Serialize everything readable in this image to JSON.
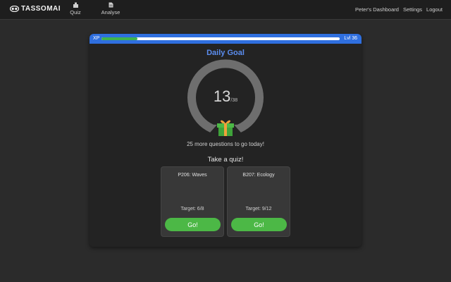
{
  "app": {
    "logo_text": "TASSOMAI"
  },
  "nav": {
    "quiz_label": "Quiz",
    "analyse_label": "Analyse"
  },
  "header_links": {
    "dashboard": "Peter's Dashboard",
    "settings": "Settings",
    "logout": "Logout"
  },
  "xp": {
    "label": "XP",
    "level": "Lvl 36",
    "progress": 0.15,
    "fill_color": "#3fb34f",
    "bar_color": "#2f6fdf"
  },
  "daily_goal": {
    "title": "Daily Goal",
    "completed": "13",
    "total": "/38",
    "progress": 0.34,
    "remaining_text": "25 more questions to go today!",
    "icon": "gift-icon"
  },
  "quizzes": {
    "heading": "Take a quiz!",
    "items": [
      {
        "name": "P206: Waves",
        "target": "Target: 6/8",
        "button": "Go!"
      },
      {
        "name": "B207: Ecology",
        "target": "Target: 9/12",
        "button": "Go!"
      }
    ]
  },
  "colors": {
    "accent_blue": "#5b8def",
    "go_green": "#4cb846",
    "gauge_gray": "#6e6e6e"
  }
}
